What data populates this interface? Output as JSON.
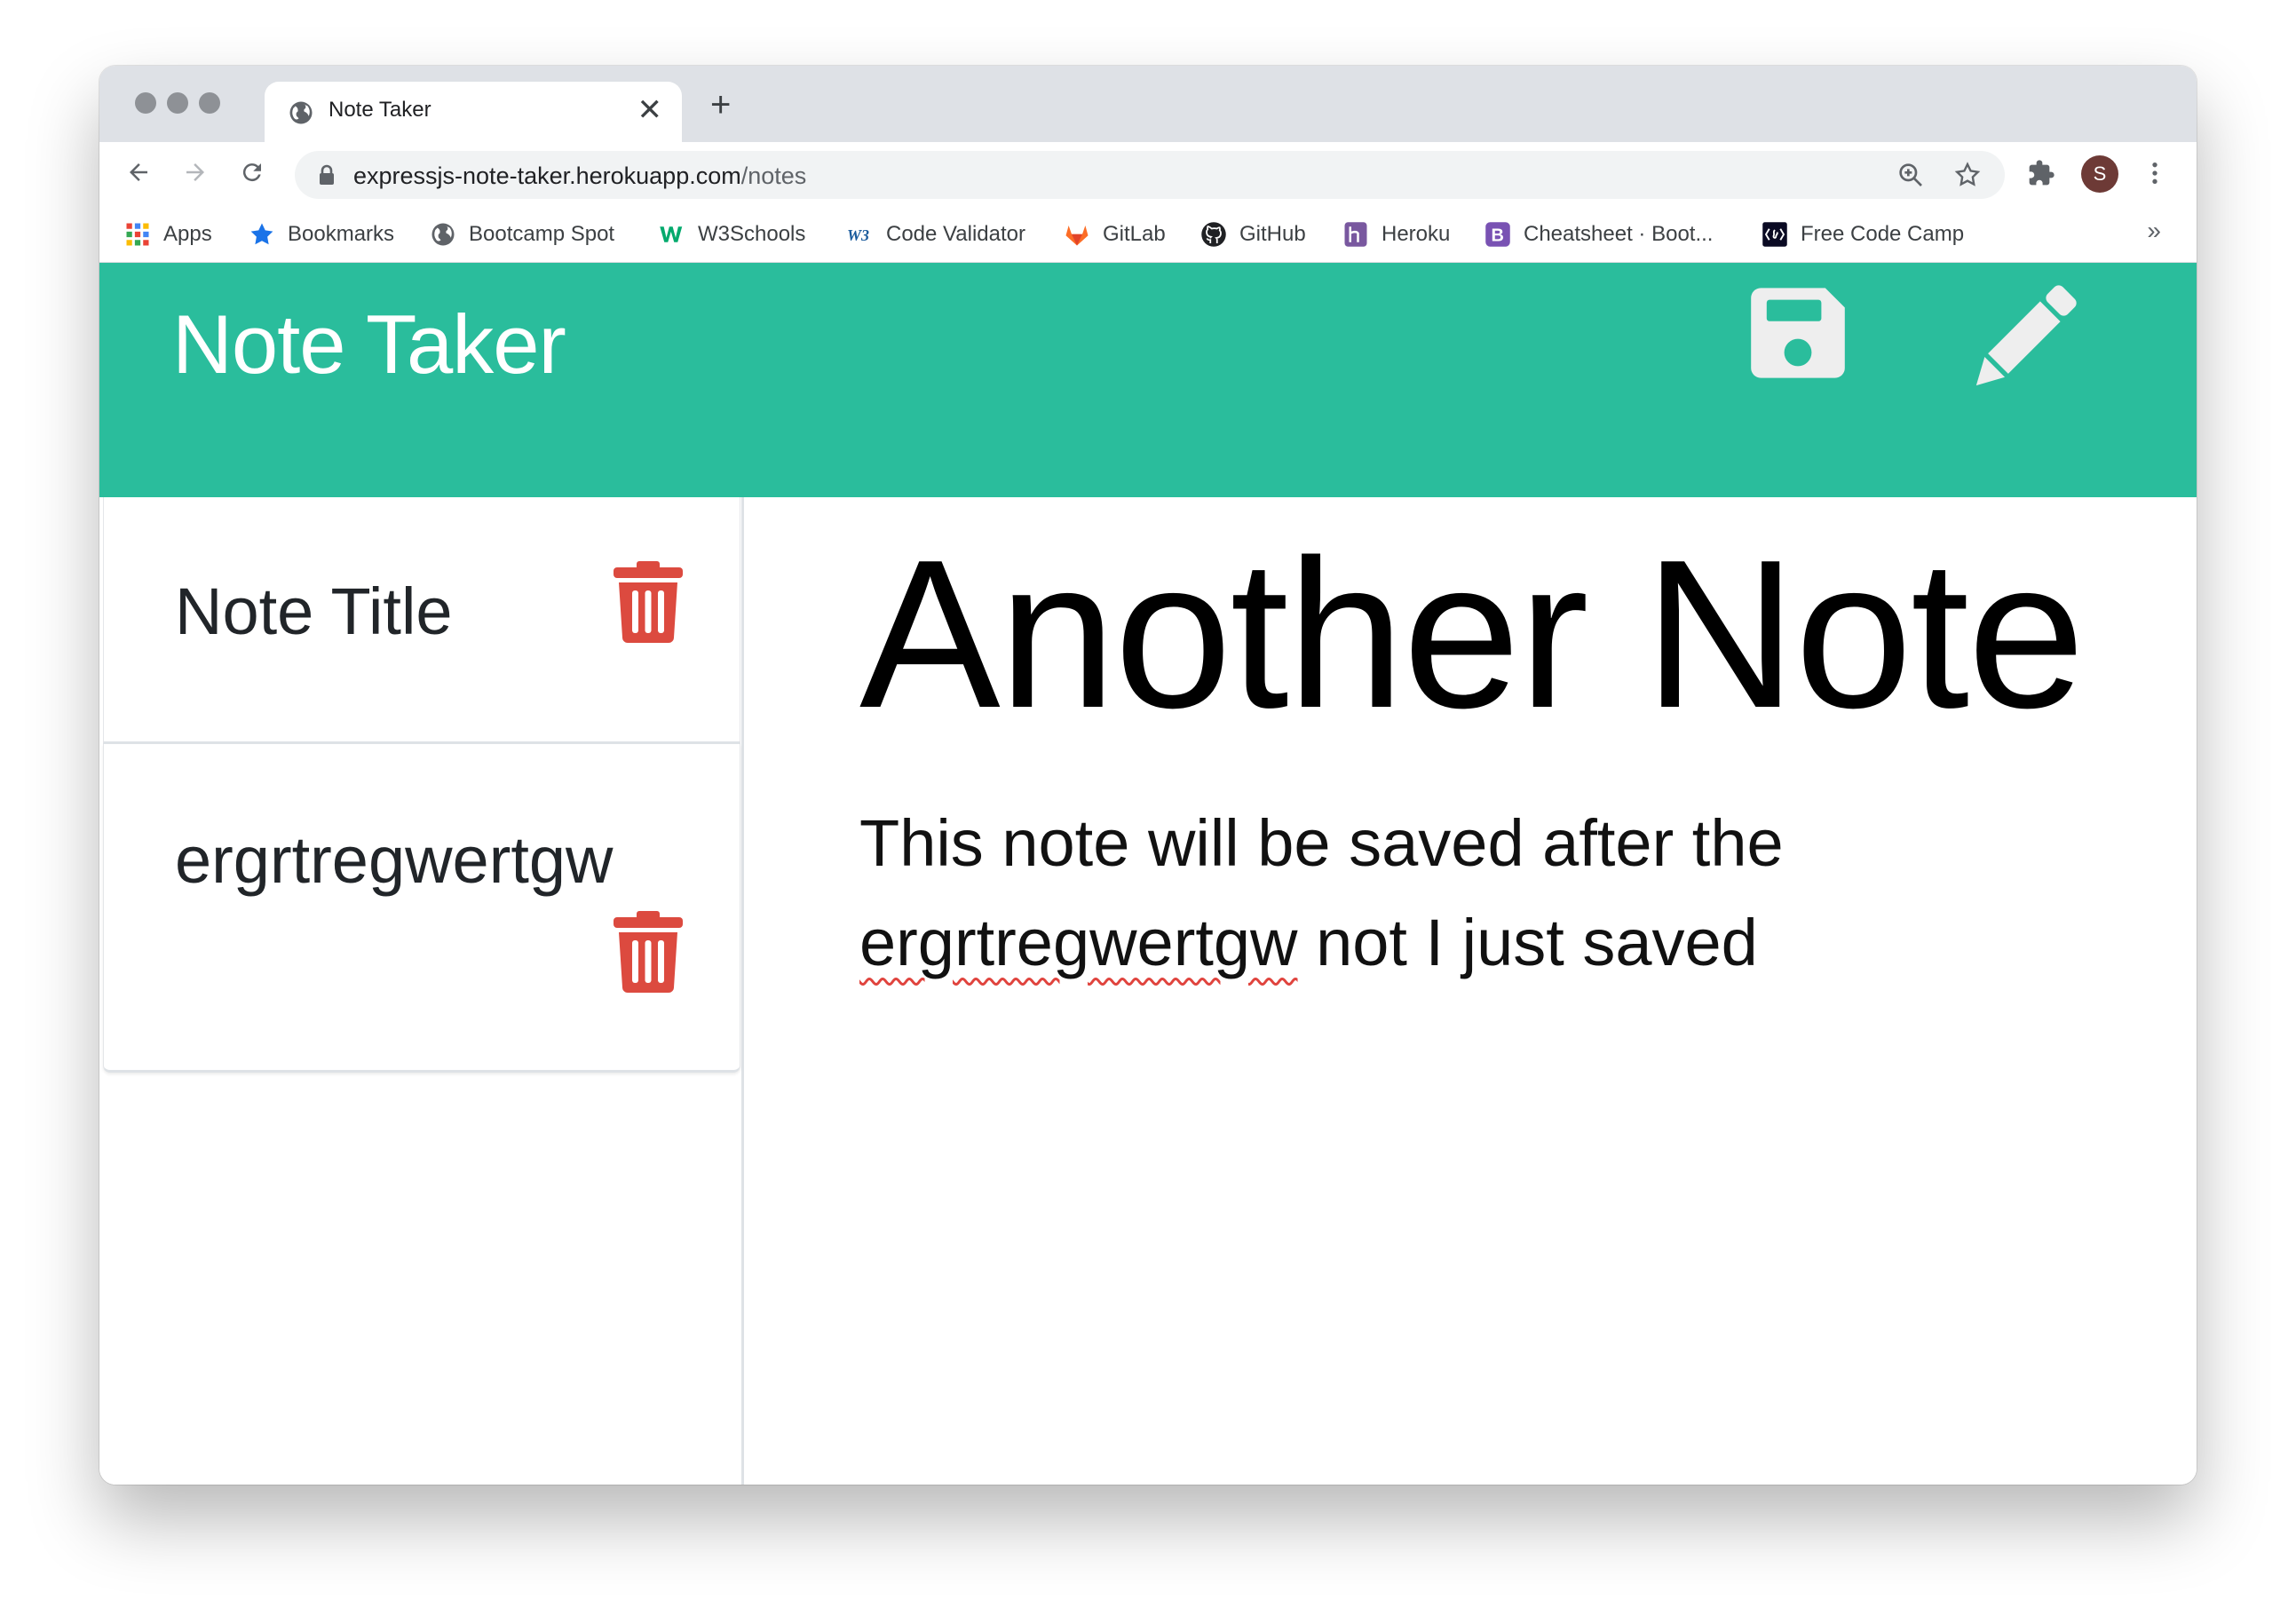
{
  "browser": {
    "tab": {
      "title": "Note Taker",
      "close": "✕"
    },
    "new_tab": "+",
    "url": {
      "host": "expressjs-note-taker.herokuapp.com",
      "path": "/notes"
    },
    "avatar_initial": "S",
    "bookmarks": [
      {
        "label": "Apps",
        "icon": "apps-grid-icon"
      },
      {
        "label": "Bookmarks",
        "icon": "star-icon"
      },
      {
        "label": "Bootcamp Spot",
        "icon": "globe-icon"
      },
      {
        "label": "W3Schools",
        "icon": "w3schools-icon"
      },
      {
        "label": "Code Validator",
        "icon": "w3c-icon"
      },
      {
        "label": "GitLab",
        "icon": "gitlab-icon"
      },
      {
        "label": "GitHub",
        "icon": "github-icon"
      },
      {
        "label": "Heroku",
        "icon": "heroku-icon"
      },
      {
        "label": "Cheatsheet · Boot...",
        "icon": "bootstrap-icon"
      },
      {
        "label": "Free Code Camp",
        "icon": "freecodecamp-icon"
      }
    ],
    "bookmarks_more": "»"
  },
  "app": {
    "title": "Note Taker",
    "accent_color": "#2abd9c",
    "delete_color": "#dc4a3f"
  },
  "notes": [
    {
      "title": "Note Title"
    },
    {
      "title": "ergrtregwertgw"
    }
  ],
  "active_note": {
    "title": "Another Note",
    "body_part1": "This note will be saved after the ",
    "body_misspelled": "ergrtregwertgw",
    "body_part2": " not I just saved"
  }
}
